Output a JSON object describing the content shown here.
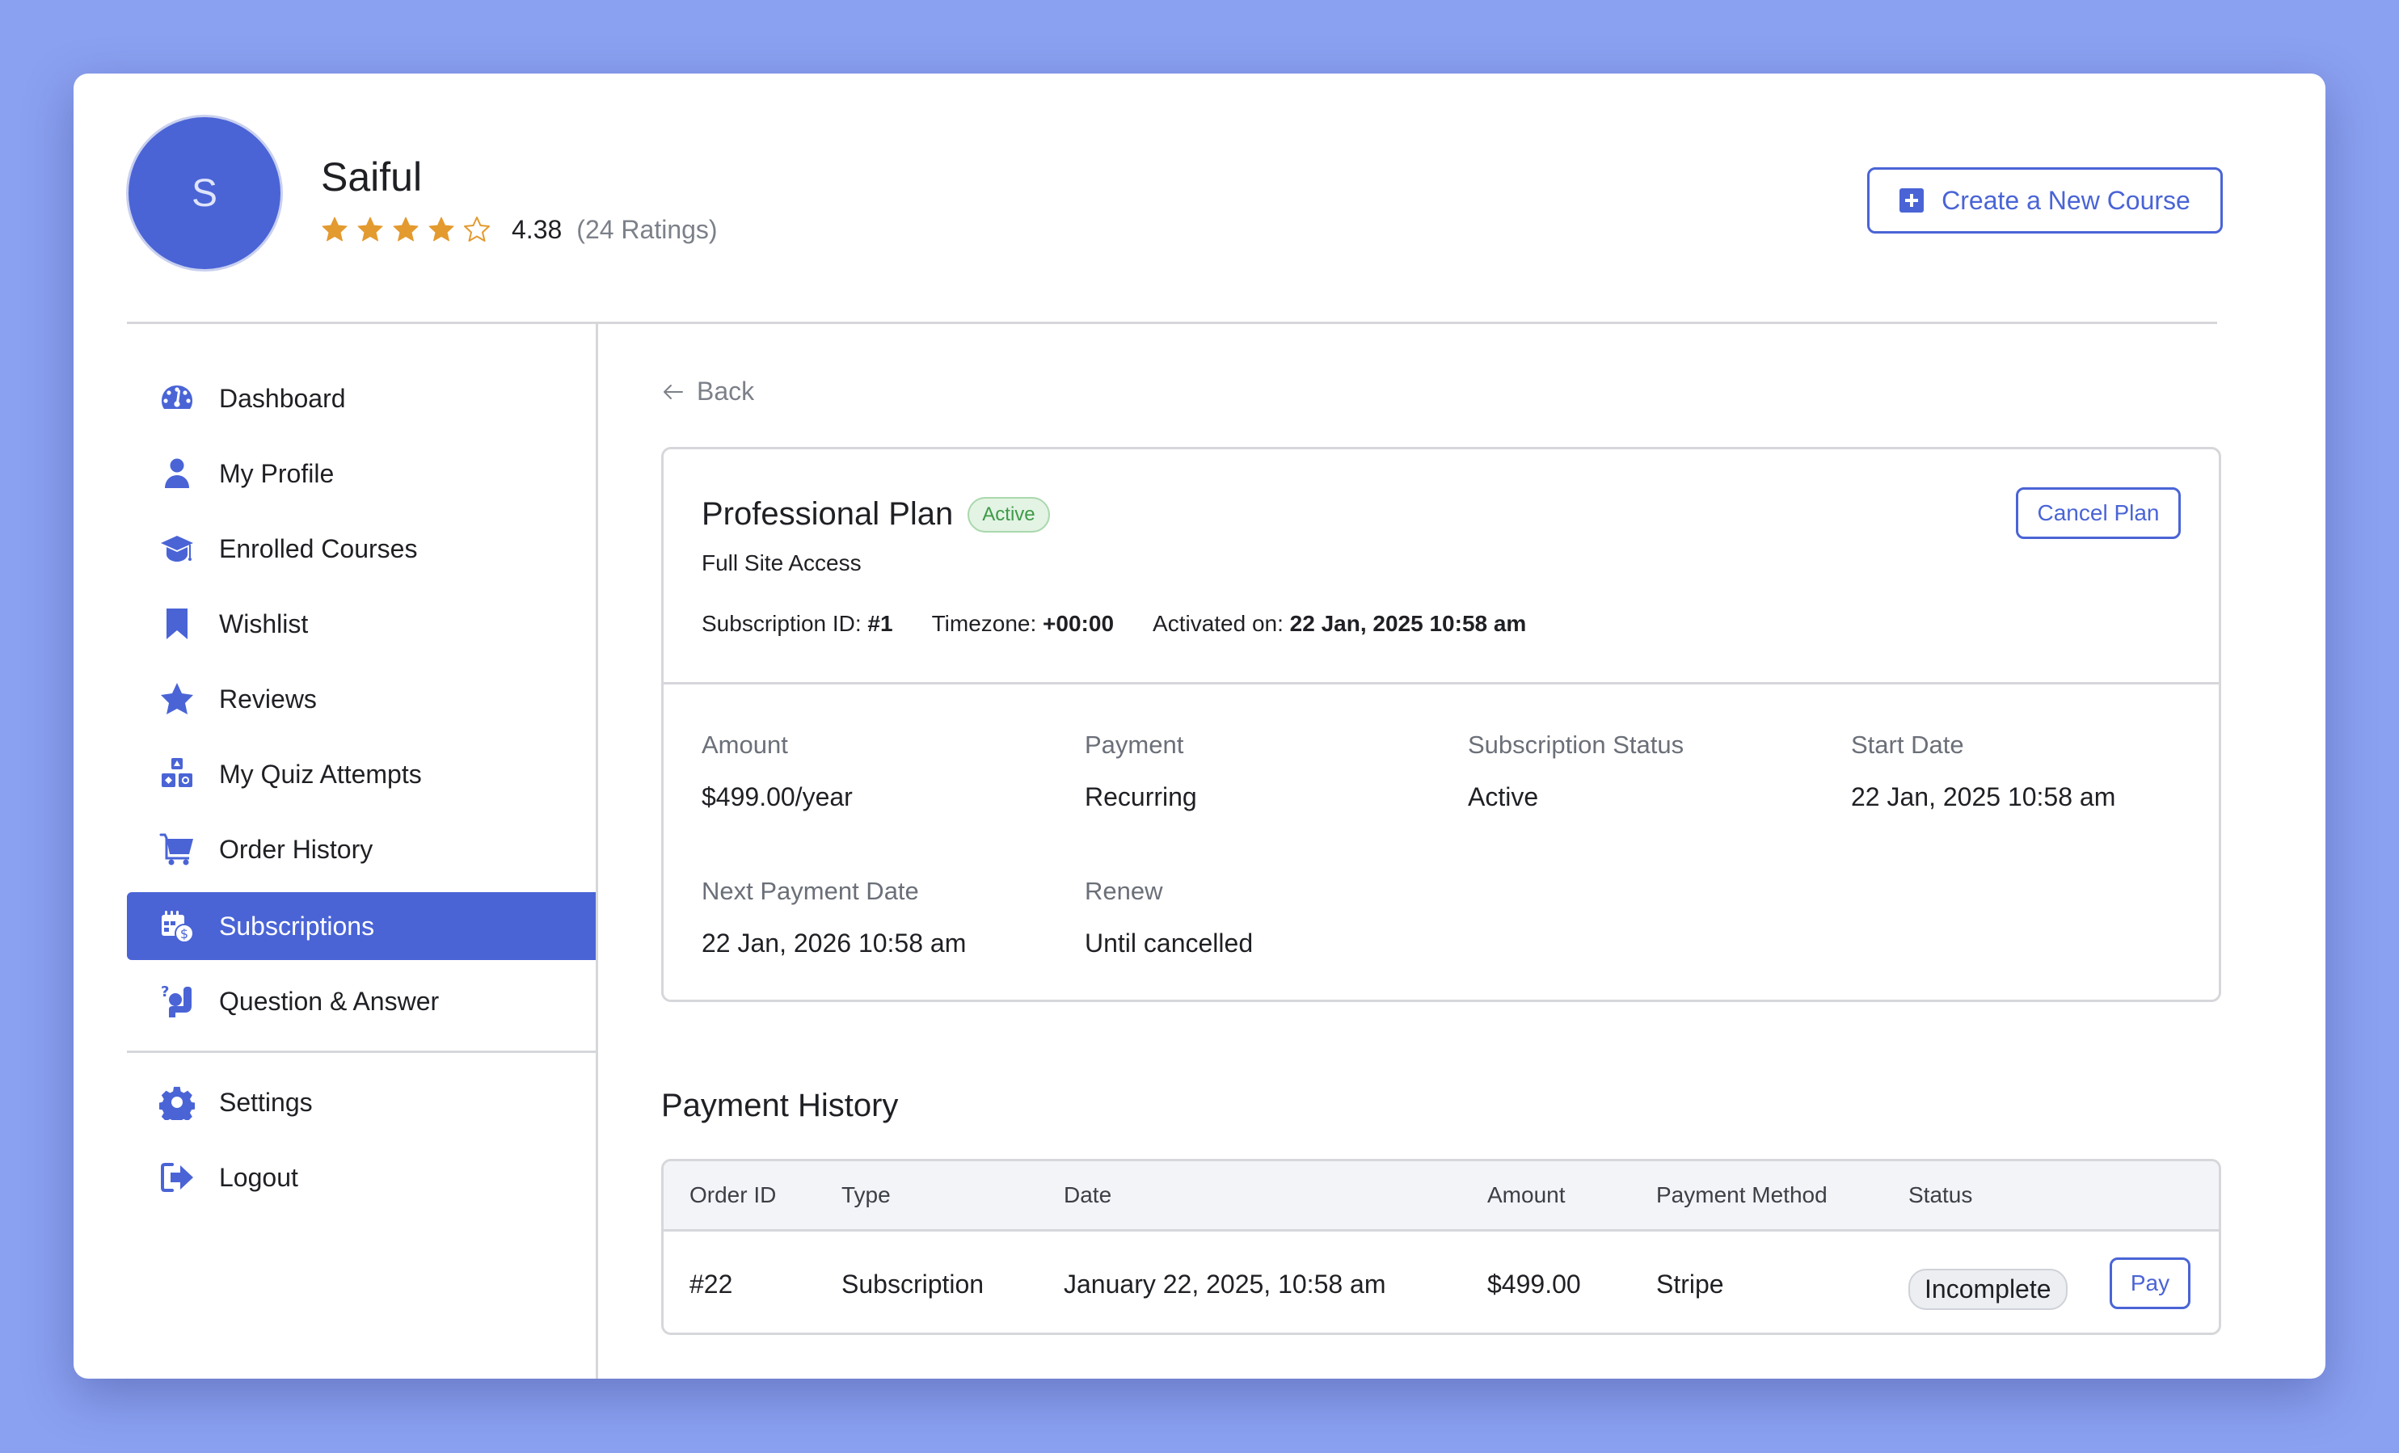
{
  "profile": {
    "avatar_initial": "S",
    "name": "Saiful",
    "rating_value": "4.38",
    "rating_stars": 4.38,
    "rating_max": 5,
    "rating_count": "(24 Ratings)"
  },
  "header": {
    "create_course_label": "Create a New Course",
    "create_course_icon": "plus-square-icon"
  },
  "sidebar": {
    "active_item": "Subscriptions",
    "items": [
      {
        "label": "Dashboard",
        "icon": "dashboard-gauge-icon"
      },
      {
        "label": "My Profile",
        "icon": "user-icon"
      },
      {
        "label": "Enrolled Courses",
        "icon": "graduation-cap-icon"
      },
      {
        "label": "Wishlist",
        "icon": "bookmark-icon"
      },
      {
        "label": "Reviews",
        "icon": "star-icon"
      },
      {
        "label": "My Quiz Attempts",
        "icon": "quiz-shapes-icon"
      },
      {
        "label": "Order History",
        "icon": "cart-icon"
      },
      {
        "label": "Subscriptions",
        "icon": "calendar-dollar-icon"
      },
      {
        "label": "Question & Answer",
        "icon": "question-hand-icon"
      }
    ],
    "bottom_items": [
      {
        "label": "Settings",
        "icon": "gear-icon"
      },
      {
        "label": "Logout",
        "icon": "logout-icon"
      }
    ]
  },
  "content": {
    "back_label": "Back",
    "plan": {
      "title": "Professional Plan",
      "status_badge": "Active",
      "subtitle": "Full Site Access",
      "cancel_label": "Cancel Plan",
      "meta": {
        "subscription_id_label": "Subscription ID:",
        "subscription_id": "#1",
        "timezone_label": "Timezone:",
        "timezone": "+00:00",
        "activated_label": "Activated on:",
        "activated": "22 Jan, 2025 10:58 am"
      },
      "details": [
        {
          "label": "Amount",
          "value": "$499.00/year"
        },
        {
          "label": "Payment",
          "value": "Recurring"
        },
        {
          "label": "Subscription Status",
          "value": "Active"
        },
        {
          "label": "Start Date",
          "value": "22 Jan, 2025 10:58 am"
        },
        {
          "label": "Next Payment Date",
          "value": "22 Jan, 2026 10:58 am"
        },
        {
          "label": "Renew",
          "value": "Until cancelled"
        }
      ]
    },
    "payment_history": {
      "title": "Payment History",
      "columns": [
        "Order ID",
        "Type",
        "Date",
        "Amount",
        "Payment Method",
        "Status"
      ],
      "rows": [
        {
          "order_id": "#22",
          "type": "Subscription",
          "date": "January 22, 2025, 10:58 am",
          "amount": "$499.00",
          "payment_method": "Stripe",
          "status": "Incomplete",
          "action_label": "Pay"
        }
      ]
    }
  },
  "colors": {
    "accent": "#4a64d6",
    "background": "#8aa0f0",
    "star": "#e39a2f",
    "active_badge_text": "#3e9a48",
    "active_badge_bg": "#e3f3e4",
    "incomplete_badge_bg": "#eceef2"
  }
}
